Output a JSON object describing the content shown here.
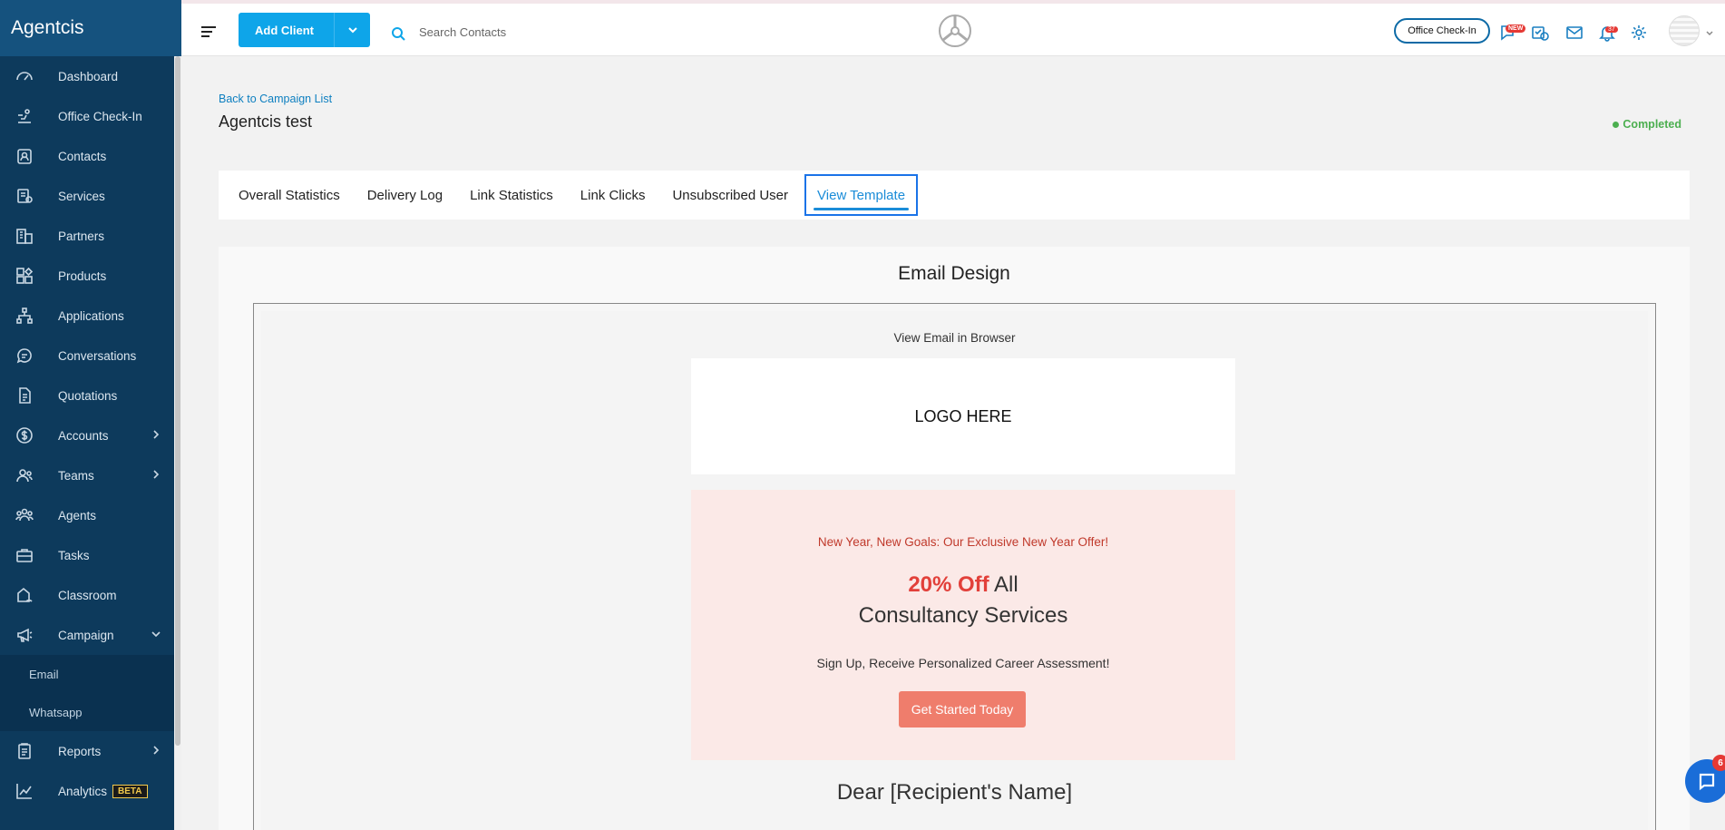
{
  "app": {
    "brand": "Agentcis"
  },
  "sidebar": {
    "items": [
      {
        "label": "Dashboard",
        "icon": "dashboard-icon"
      },
      {
        "label": "Office Check-In",
        "icon": "check-in-icon"
      },
      {
        "label": "Contacts",
        "icon": "contacts-icon"
      },
      {
        "label": "Services",
        "icon": "services-icon"
      },
      {
        "label": "Partners",
        "icon": "partners-icon"
      },
      {
        "label": "Products",
        "icon": "products-icon"
      },
      {
        "label": "Applications",
        "icon": "applications-icon"
      },
      {
        "label": "Conversations",
        "icon": "conversations-icon"
      },
      {
        "label": "Quotations",
        "icon": "quotations-icon"
      },
      {
        "label": "Accounts",
        "icon": "accounts-icon"
      },
      {
        "label": "Teams",
        "icon": "teams-icon"
      },
      {
        "label": "Agents",
        "icon": "agents-icon"
      },
      {
        "label": "Tasks",
        "icon": "tasks-icon"
      },
      {
        "label": "Classroom",
        "icon": "classroom-icon"
      },
      {
        "label": "Campaign",
        "icon": "campaign-icon"
      },
      {
        "label": "Reports",
        "icon": "reports-icon"
      },
      {
        "label": "Analytics",
        "icon": "analytics-icon",
        "badge": "BETA"
      }
    ],
    "campaign_sub": [
      "Email",
      "Whatsapp"
    ]
  },
  "topbar": {
    "add_client_label": "Add Client",
    "search_placeholder": "Search Contacts",
    "office_checkin_label": "Office Check-In",
    "new_badge": "NEW",
    "notification_count": "37"
  },
  "page": {
    "back_link": "Back to Campaign List",
    "title": "Agentcis test",
    "status": "Completed",
    "status_color": "#4caf50",
    "tabs": [
      "Overall Statistics",
      "Delivery Log",
      "Link Statistics",
      "Link Clicks",
      "Unsubscribed User",
      "View Template"
    ],
    "active_tab": "View Template"
  },
  "email": {
    "section_title": "Email Design",
    "view_in_browser": "View Email in Browser",
    "logo_placeholder": "LOGO HERE",
    "headline": "New Year, New Goals: Our Exclusive New Year Offer!",
    "offer_strong": "20% Off",
    "offer_rest_line1": "All",
    "offer_line2": "Consultancy Services",
    "subtext": "Sign Up, Receive Personalized Career Assessment!",
    "cta_label": "Get Started Today",
    "greeting": "Dear [Recipient's Name]"
  },
  "chat": {
    "unread": "6"
  },
  "colors": {
    "sidebar": "#0d3a5c",
    "accent": "#0ea5e9",
    "cta": "#ef7d6c",
    "offer": "#e2403a"
  }
}
